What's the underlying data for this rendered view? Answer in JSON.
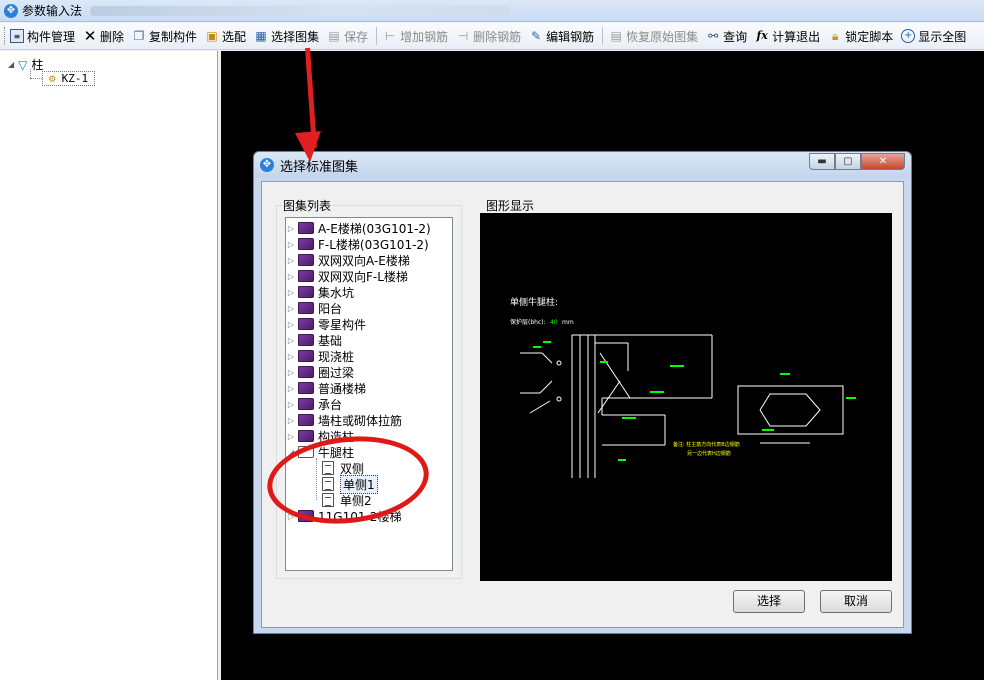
{
  "window": {
    "title": "参数输入法"
  },
  "toolbar": {
    "items": [
      {
        "label": "构件管理",
        "icon": "component-manage-icon",
        "enabled": true
      },
      {
        "label": "删除",
        "icon": "delete-x-icon",
        "enabled": true
      },
      {
        "label": "复制构件",
        "icon": "copy-icon",
        "enabled": true
      },
      {
        "label": "选配",
        "icon": "select-config-icon",
        "enabled": true
      },
      {
        "label": "选择图集",
        "icon": "atlas-select-icon",
        "enabled": true
      },
      {
        "label": "保存",
        "icon": "save-disk-icon",
        "enabled": false
      },
      {
        "label": "增加钢筋",
        "icon": "add-rebar-icon",
        "enabled": false
      },
      {
        "label": "删除钢筋",
        "icon": "delete-rebar-icon",
        "enabled": false
      },
      {
        "label": "编辑钢筋",
        "icon": "edit-rebar-icon",
        "enabled": true
      },
      {
        "label": "恢复原始图集",
        "icon": "restore-atlas-icon",
        "enabled": false
      },
      {
        "label": "查询",
        "icon": "binoculars-icon",
        "enabled": true
      },
      {
        "label": "计算退出",
        "icon": "fx-icon",
        "enabled": true
      },
      {
        "label": "锁定脚本",
        "icon": "lock-icon",
        "enabled": true
      },
      {
        "label": "显示全图",
        "icon": "zoom-fit-icon",
        "enabled": true
      }
    ]
  },
  "tree": {
    "root_label": "柱",
    "child_label": "KZ-1"
  },
  "dialog": {
    "title": "选择标准图集",
    "list_group_label": "图集列表",
    "preview_group_label": "图形显示",
    "atlas_items": [
      "A-E楼梯(03G101-2)",
      "F-L楼梯(03G101-2)",
      "双网双向A-E楼梯",
      "双网双向F-L楼梯",
      "集水坑",
      "阳台",
      "零星构件",
      "基础",
      "现浇桩",
      "圈过梁",
      "普通楼梯",
      "承台",
      "墙柱或砌体拉筋",
      "构造柱"
    ],
    "expanded_item": "牛腿柱",
    "children": [
      "双侧",
      "单侧1",
      "单侧2"
    ],
    "selected_child": "单侧1",
    "last_item": "11G101-2楼梯",
    "select_button": "选择",
    "cancel_button": "取消",
    "preview": {
      "heading": "单侧牛腿柱:",
      "cover_label": "保护层(bhc):",
      "cover_value": "40",
      "cover_unit": "mm",
      "note_line1": "备注: 柱主筋方向代表B边钢筋",
      "note_line2": "另一边代表H边钢筋"
    }
  },
  "colors": {
    "annotation_red": "#e02020",
    "cad_background": "#000000",
    "cad_line": "#ffffff",
    "cad_text_green": "#00ff00",
    "cad_text_yellow": "#ffff00"
  }
}
